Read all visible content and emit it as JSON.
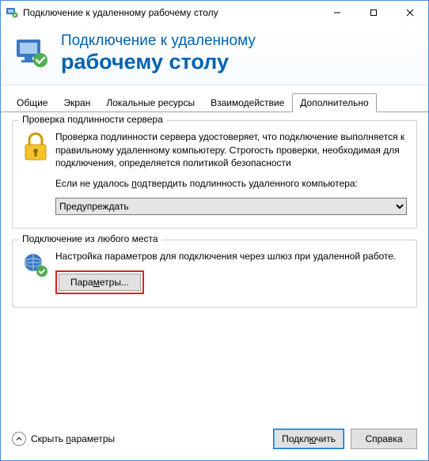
{
  "titlebar": {
    "title": "Подключение к удаленному рабочему столу"
  },
  "header": {
    "line1": "Подключение к удаленному",
    "line2": "рабочему столу"
  },
  "tabs": {
    "items": [
      {
        "label": "Общие"
      },
      {
        "label": "Экран"
      },
      {
        "label": "Локальные ресурсы"
      },
      {
        "label": "Взаимодействие"
      },
      {
        "label": "Дополнительно"
      }
    ],
    "active": 4
  },
  "group1": {
    "title": "Проверка подлинности сервера",
    "text1": "Проверка подлинности сервера удостоверяет, что подключение выполняется к правильному удаленному компьютеру. Строгость проверки, необходимая для подключения, определяется политикой безопасности",
    "text2_a": "Если не удалось ",
    "text2_u": "п",
    "text2_b": "одтвердить подлинность удаленного компьютера:",
    "select_value": "Предупреждать"
  },
  "group2": {
    "title": "Подключение из любого места",
    "text": "Настройка параметров для подключения через шлюз при удаленной работе.",
    "button_a": "Пара",
    "button_u": "м",
    "button_b": "етры..."
  },
  "footer": {
    "collapse_a": "Скрыть ",
    "collapse_u": "п",
    "collapse_b": "араметры",
    "connect_a": "Подкл",
    "connect_u": "ю",
    "connect_b": "чить",
    "help": "Справка"
  }
}
